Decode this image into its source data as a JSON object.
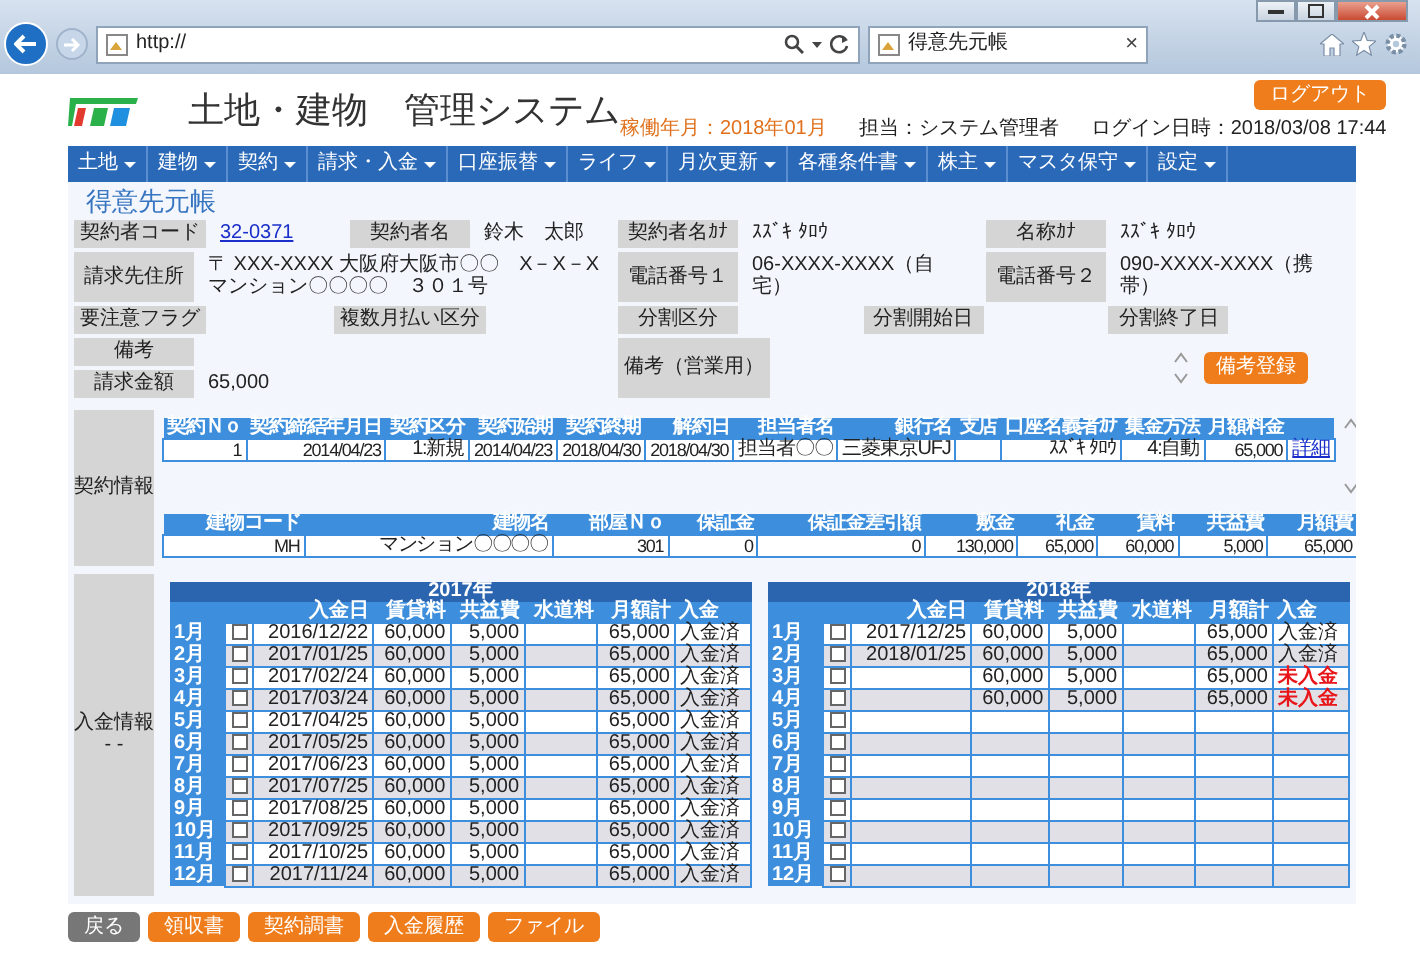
{
  "browser": {
    "address": "http://",
    "tab_title": "得意先元帳",
    "tab_close": "×"
  },
  "header": {
    "system_title": "土地・建物　管理システム",
    "logout": "ログアウト",
    "period": "稼働年月：2018年01月",
    "user": "担当：システム管理者",
    "login_time": "ログイン日時：2018/03/08 17:44"
  },
  "menu": [
    "土地",
    "建物",
    "契約",
    "請求・入金",
    "口座振替",
    "ライフ",
    "月次更新",
    "各種条件書",
    "株主",
    "マスタ保守",
    "設定"
  ],
  "page_title": "得意先元帳",
  "info": {
    "left": [
      [
        {
          "label": "契約者コード",
          "value": "32-0371",
          "kind": "link"
        },
        {
          "label": "契約者名",
          "value": "鈴木　太郎",
          "kind": "text"
        }
      ],
      [
        {
          "label": "請求先住所",
          "value": "〒 XXX-XXXX 大阪府大阪市〇〇　X－X－X マンション〇〇〇〇　３０１号",
          "kind": "text"
        }
      ],
      [
        {
          "label": "要注意フラグ"
        },
        {
          "label": "複数月払い区分"
        }
      ],
      [
        {
          "label": "備考"
        }
      ],
      [
        {
          "label": "請求金額",
          "value": "65,000",
          "kind": "text"
        }
      ]
    ],
    "right": [
      [
        {
          "label": "契約者名ｶﾅ",
          "value": "ｽｽﾞｷ ﾀﾛｳ",
          "kind": "text"
        },
        {
          "label": "名称ｶﾅ",
          "value": "ｽｽﾞｷ ﾀﾛｳ",
          "kind": "text"
        }
      ],
      [
        {
          "label": "電話番号１",
          "value": "06-XXXX-XXXX（自宅）",
          "kind": "text"
        },
        {
          "label": "電話番号２",
          "value": "090-XXXX-XXXX（携帯）",
          "kind": "text"
        }
      ],
      [
        {
          "label": "分割区分"
        },
        {
          "label": "分割開始日"
        },
        {
          "label": "分割終了日"
        }
      ]
    ],
    "remarks": {
      "label": "備考（営業用）",
      "button": "備考登録"
    }
  },
  "contract": {
    "label": "契約情報",
    "tables": [
      {
        "columns": [
          "契約Ｎｏ",
          "契約締結年月日",
          "契約区分",
          "契約始期",
          "契約終期",
          "解約日",
          "担当者名",
          "銀行名",
          "支店",
          "口座名義者ｶﾅ",
          "集金方法",
          "月額料金",
          null
        ],
        "rows": [
          [
            "1",
            "2014/04/23",
            "1:新規",
            "2014/04/23",
            "2018/04/30",
            "2018/04/30",
            "担当者〇〇",
            "三菱東京UFJ",
            null,
            "ｽｽﾞｷ ﾀﾛｳ",
            "4:自動",
            "65,000",
            {
              "link": "詳細"
            }
          ]
        ]
      },
      {
        "columns": [
          "建物コード",
          "建物名",
          "部屋Ｎｏ",
          "保証金",
          "保証金差引額",
          "敷金",
          "礼金",
          "賃料",
          "共益費",
          "月額費"
        ],
        "rows": [
          [
            "MH",
            "マンション〇〇〇〇",
            "301",
            "0",
            "0",
            "130,000",
            "65,000",
            "60,000",
            "5,000",
            "65,000"
          ]
        ]
      }
    ]
  },
  "payments": {
    "label": "入金情報",
    "sub": "- -",
    "years": [
      {
        "year": "2017年",
        "columns": [
          "入金日",
          "賃貸料",
          "共益費",
          "水道料",
          "月額計",
          "入金"
        ],
        "rows": [
          {
            "month": "1月",
            "checked": false,
            "date": "2016/12/22",
            "rent": "60,000",
            "common": "5,000",
            "total": "65,000",
            "status": {
              "text": "入金済",
              "kind": "paid"
            }
          },
          {
            "month": "2月",
            "checked": false,
            "date": "2017/01/25",
            "rent": "60,000",
            "common": "5,000",
            "total": "65,000",
            "status": {
              "text": "入金済",
              "kind": "paid"
            }
          },
          {
            "month": "3月",
            "checked": false,
            "date": "2017/02/24",
            "rent": "60,000",
            "common": "5,000",
            "total": "65,000",
            "status": {
              "text": "入金済",
              "kind": "paid"
            }
          },
          {
            "month": "4月",
            "checked": false,
            "date": "2017/03/24",
            "rent": "60,000",
            "common": "5,000",
            "total": "65,000",
            "status": {
              "text": "入金済",
              "kind": "paid"
            }
          },
          {
            "month": "5月",
            "checked": false,
            "date": "2017/04/25",
            "rent": "60,000",
            "common": "5,000",
            "total": "65,000",
            "status": {
              "text": "入金済",
              "kind": "paid"
            }
          },
          {
            "month": "6月",
            "checked": false,
            "date": "2017/05/25",
            "rent": "60,000",
            "common": "5,000",
            "total": "65,000",
            "status": {
              "text": "入金済",
              "kind": "paid"
            }
          },
          {
            "month": "7月",
            "checked": false,
            "date": "2017/06/23",
            "rent": "60,000",
            "common": "5,000",
            "total": "65,000",
            "status": {
              "text": "入金済",
              "kind": "paid"
            }
          },
          {
            "month": "8月",
            "checked": false,
            "date": "2017/07/25",
            "rent": "60,000",
            "common": "5,000",
            "total": "65,000",
            "status": {
              "text": "入金済",
              "kind": "paid"
            }
          },
          {
            "month": "9月",
            "checked": false,
            "date": "2017/08/25",
            "rent": "60,000",
            "common": "5,000",
            "total": "65,000",
            "status": {
              "text": "入金済",
              "kind": "paid"
            }
          },
          {
            "month": "10月",
            "checked": false,
            "date": "2017/09/25",
            "rent": "60,000",
            "common": "5,000",
            "total": "65,000",
            "status": {
              "text": "入金済",
              "kind": "paid"
            }
          },
          {
            "month": "11月",
            "checked": false,
            "date": "2017/10/25",
            "rent": "60,000",
            "common": "5,000",
            "total": "65,000",
            "status": {
              "text": "入金済",
              "kind": "paid"
            }
          },
          {
            "month": "12月",
            "checked": false,
            "date": "2017/11/24",
            "rent": "60,000",
            "common": "5,000",
            "total": "65,000",
            "status": {
              "text": "入金済",
              "kind": "paid"
            }
          }
        ]
      },
      {
        "year": "2018年",
        "columns": [
          "入金日",
          "賃貸料",
          "共益費",
          "水道料",
          "月額計",
          "入金"
        ],
        "rows": [
          {
            "month": "1月",
            "checked": false,
            "date": "2017/12/25",
            "rent": "60,000",
            "common": "5,000",
            "total": "65,000",
            "status": {
              "text": "入金済",
              "kind": "paid"
            }
          },
          {
            "month": "2月",
            "checked": false,
            "date": "2018/01/25",
            "rent": "60,000",
            "common": "5,000",
            "total": "65,000",
            "status": {
              "text": "入金済",
              "kind": "paid"
            }
          },
          {
            "month": "3月",
            "checked": false,
            "rent": "60,000",
            "common": "5,000",
            "total": "65,000",
            "status": {
              "text": "未入金",
              "kind": "unpaid"
            }
          },
          {
            "month": "4月",
            "checked": false,
            "rent": "60,000",
            "common": "5,000",
            "total": "65,000",
            "status": {
              "text": "未入金",
              "kind": "unpaid"
            }
          },
          {
            "month": "5月",
            "checked": false
          },
          {
            "month": "6月",
            "checked": false
          },
          {
            "month": "7月",
            "checked": false
          },
          {
            "month": "8月",
            "checked": false
          },
          {
            "month": "9月",
            "checked": false
          },
          {
            "month": "10月",
            "checked": false
          },
          {
            "month": "11月",
            "checked": false
          },
          {
            "month": "12月",
            "checked": false
          }
        ]
      }
    ]
  },
  "buttons": [
    {
      "label": "戻る",
      "kind": "secondary"
    },
    {
      "label": "領収書",
      "kind": "primary"
    },
    {
      "label": "契約調書",
      "kind": "primary"
    },
    {
      "label": "入金履歴",
      "kind": "primary"
    },
    {
      "label": "ファイル",
      "kind": "primary"
    }
  ]
}
